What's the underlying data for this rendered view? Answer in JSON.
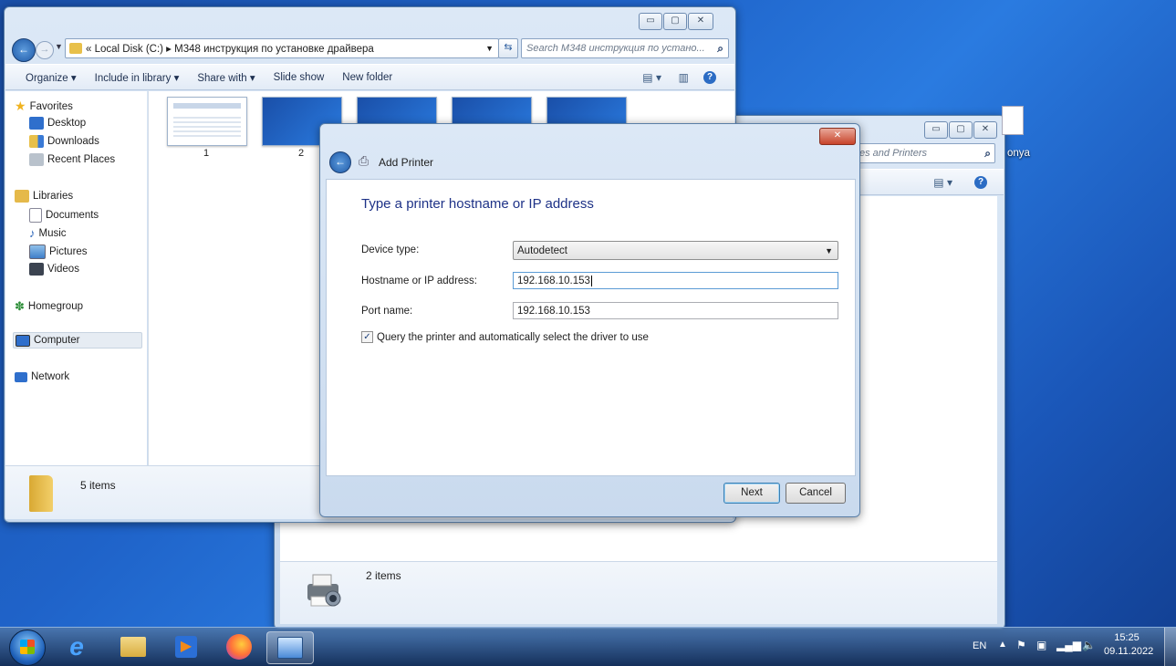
{
  "explorer": {
    "breadcrumb": "« Local Disk (C:) ▸ M348 инструкция по установке драйвера",
    "search_placeholder": "Search M348 инструкция по устано...",
    "toolbar": {
      "organize": "Organize ▾",
      "include_in_library": "Include in library ▾",
      "share_with": "Share with ▾",
      "slide_show": "Slide show",
      "new_folder": "New folder"
    },
    "nav": {
      "favorites": "Favorites",
      "desktop": "Desktop",
      "downloads": "Downloads",
      "recent_places": "Recent Places",
      "libraries": "Libraries",
      "documents": "Documents",
      "music": "Music",
      "pictures": "Pictures",
      "videos": "Videos",
      "homegroup": "Homegroup",
      "computer": "Computer",
      "network": "Network"
    },
    "thumbnails": [
      "1",
      "2"
    ],
    "status": "5 items"
  },
  "devices_window": {
    "search_placeholder": "es and Printers",
    "status": "2 items"
  },
  "desktop": {
    "icon_label": "onya"
  },
  "dialog": {
    "title": "Add Printer",
    "heading": "Type a printer hostname or IP address",
    "device_type_label": "Device type:",
    "device_type_value": "Autodetect",
    "hostname_label": "Hostname or IP address:",
    "hostname_value": "192.168.10.153",
    "port_label": "Port name:",
    "port_value": "192.168.10.153",
    "query_checkbox_label": "Query the printer and automatically select the driver to use",
    "next": "Next",
    "cancel": "Cancel"
  },
  "taskbar": {
    "language": "EN",
    "time": "15:25",
    "date": "09.11.2022"
  },
  "colors": {
    "desktop_blue": "#1f63c9",
    "glass": "#c9daee",
    "selection": "#cce4f7"
  }
}
